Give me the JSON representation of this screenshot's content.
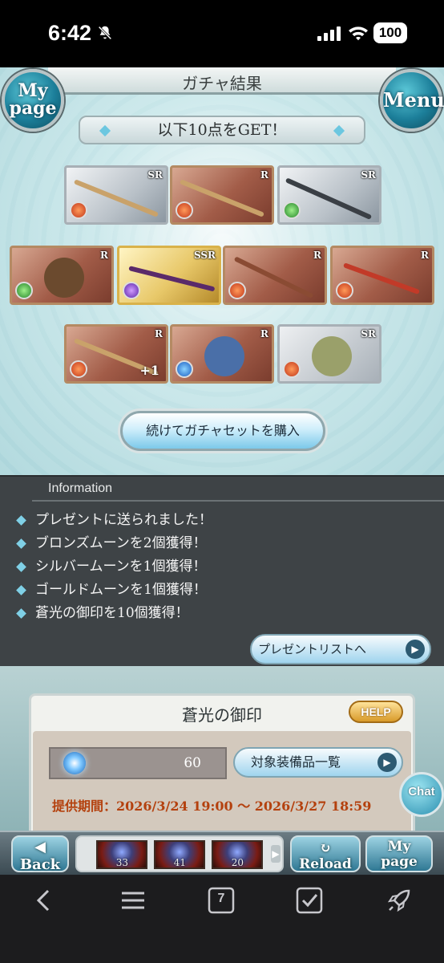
{
  "status_bar": {
    "time": "6:42",
    "battery": "100"
  },
  "header": {
    "title": "ガチャ結果",
    "mypage_label": "My page",
    "mypage_line1": "My",
    "mypage_line2": "page",
    "menu_label": "Menu"
  },
  "result": {
    "banner": "以下10点をGET！",
    "items": [
      {
        "rarity": "SR",
        "element": "fire",
        "kind": "spear"
      },
      {
        "rarity": "R",
        "element": "fire",
        "kind": "spear"
      },
      {
        "rarity": "SR",
        "element": "wind",
        "kind": "sword"
      },
      {
        "rarity": "R",
        "element": "wind",
        "kind": "shield"
      },
      {
        "rarity": "SSR",
        "element": "dark",
        "kind": "claw"
      },
      {
        "rarity": "R",
        "element": "fire",
        "kind": "staff"
      },
      {
        "rarity": "R",
        "element": "fire",
        "kind": "dagger"
      },
      {
        "rarity": "R",
        "element": "fire",
        "kind": "spear",
        "plus": "+1"
      },
      {
        "rarity": "R",
        "element": "water",
        "kind": "beast"
      },
      {
        "rarity": "SR",
        "element": "fire",
        "kind": "character"
      }
    ],
    "buy_again_label": "続けてガチャセットを購入"
  },
  "information": {
    "title": "Information",
    "lines": [
      "プレゼントに送られました！",
      "ブロンズムーンを2個獲得！",
      "シルバームーンを1個獲得！",
      "ゴールドムーンを1個獲得！",
      "蒼光の御印を10個獲得！"
    ],
    "present_list_label": "プレゼントリストへ"
  },
  "seal": {
    "title": "蒼光の御印",
    "help_label": "HELP",
    "count": "60",
    "target_list_label": "対象装備品一覧",
    "period": "提供期間：2026/3/24 19:00 〜 2026/3/27 18:59"
  },
  "chat_label": "Chat",
  "footer": {
    "back_label": "Back",
    "reload_label": "Reload",
    "mypage_line1": "My",
    "mypage_line2": "page",
    "quests": [
      "33",
      "41",
      "20"
    ]
  },
  "browser": {
    "tab_count": "7"
  },
  "colors": {
    "accent": "#2b8fb0",
    "info_bg": "#3e4346",
    "period_text": "#b4410e"
  }
}
